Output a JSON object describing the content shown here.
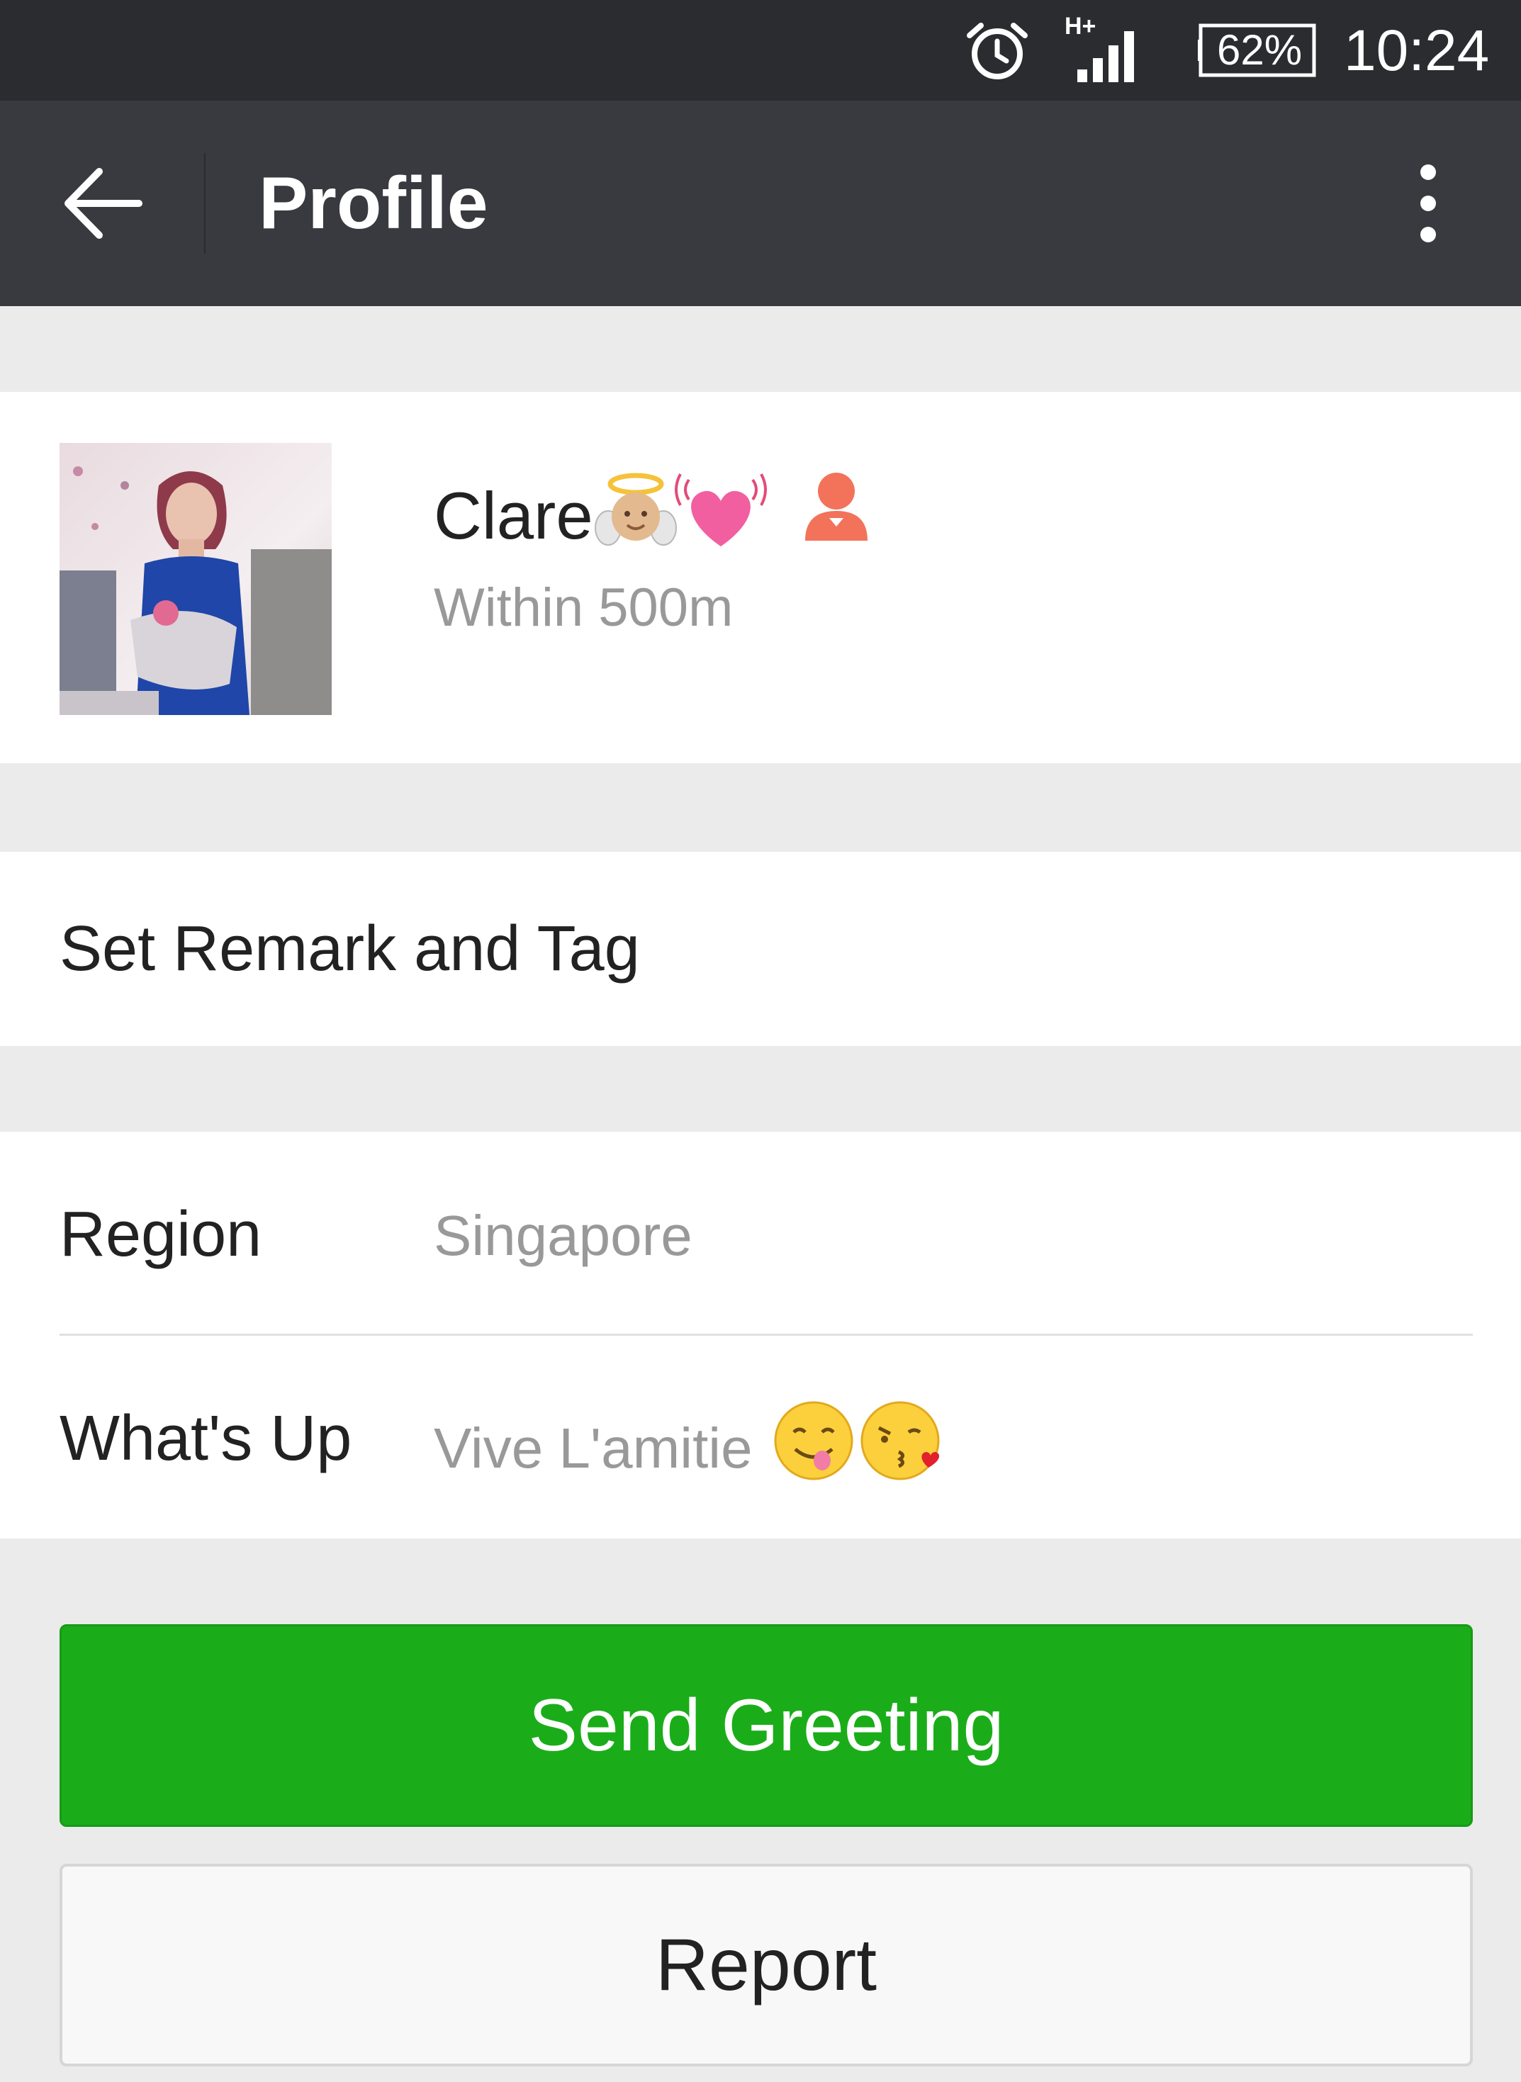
{
  "status_bar": {
    "network_type": "H+",
    "battery": "62%",
    "time": "10:24"
  },
  "header": {
    "title": "Profile",
    "back_icon": "arrow-left-icon",
    "menu_icon": "more-vertical-icon"
  },
  "profile": {
    "name": "Clare",
    "name_emojis": [
      "angel-emoji",
      "beating-heart-emoji"
    ],
    "gender_icon": "female-icon",
    "distance": "Within 500m"
  },
  "remark": {
    "label": "Set Remark and Tag"
  },
  "info": {
    "region_label": "Region",
    "region_value": "Singapore",
    "whatsup_label": "What's Up",
    "whatsup_value": "Vive L'amitie",
    "whatsup_emojis": [
      "yum-emoji",
      "kissing-heart-emoji"
    ]
  },
  "actions": {
    "send_greeting": "Send Greeting",
    "report": "Report"
  },
  "colors": {
    "status_bar_bg": "#2b2c30",
    "header_bg": "#393a3f",
    "page_bg": "#ebebeb",
    "primary_green": "#1aad19",
    "gender_female": "#f2735a"
  }
}
